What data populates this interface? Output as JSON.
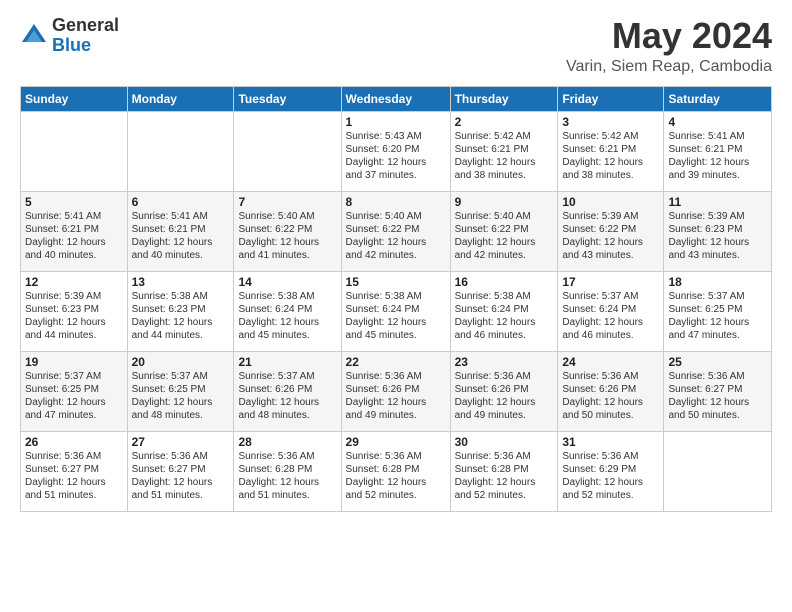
{
  "logo": {
    "general": "General",
    "blue": "Blue"
  },
  "title": "May 2024",
  "location": "Varin, Siem Reap, Cambodia",
  "days_header": [
    "Sunday",
    "Monday",
    "Tuesday",
    "Wednesday",
    "Thursday",
    "Friday",
    "Saturday"
  ],
  "weeks": [
    [
      {
        "day": "",
        "sunrise": "",
        "sunset": "",
        "daylight": ""
      },
      {
        "day": "",
        "sunrise": "",
        "sunset": "",
        "daylight": ""
      },
      {
        "day": "",
        "sunrise": "",
        "sunset": "",
        "daylight": ""
      },
      {
        "day": "1",
        "sunrise": "Sunrise: 5:43 AM",
        "sunset": "Sunset: 6:20 PM",
        "daylight": "Daylight: 12 hours and 37 minutes."
      },
      {
        "day": "2",
        "sunrise": "Sunrise: 5:42 AM",
        "sunset": "Sunset: 6:21 PM",
        "daylight": "Daylight: 12 hours and 38 minutes."
      },
      {
        "day": "3",
        "sunrise": "Sunrise: 5:42 AM",
        "sunset": "Sunset: 6:21 PM",
        "daylight": "Daylight: 12 hours and 38 minutes."
      },
      {
        "day": "4",
        "sunrise": "Sunrise: 5:41 AM",
        "sunset": "Sunset: 6:21 PM",
        "daylight": "Daylight: 12 hours and 39 minutes."
      }
    ],
    [
      {
        "day": "5",
        "sunrise": "Sunrise: 5:41 AM",
        "sunset": "Sunset: 6:21 PM",
        "daylight": "Daylight: 12 hours and 40 minutes."
      },
      {
        "day": "6",
        "sunrise": "Sunrise: 5:41 AM",
        "sunset": "Sunset: 6:21 PM",
        "daylight": "Daylight: 12 hours and 40 minutes."
      },
      {
        "day": "7",
        "sunrise": "Sunrise: 5:40 AM",
        "sunset": "Sunset: 6:22 PM",
        "daylight": "Daylight: 12 hours and 41 minutes."
      },
      {
        "day": "8",
        "sunrise": "Sunrise: 5:40 AM",
        "sunset": "Sunset: 6:22 PM",
        "daylight": "Daylight: 12 hours and 42 minutes."
      },
      {
        "day": "9",
        "sunrise": "Sunrise: 5:40 AM",
        "sunset": "Sunset: 6:22 PM",
        "daylight": "Daylight: 12 hours and 42 minutes."
      },
      {
        "day": "10",
        "sunrise": "Sunrise: 5:39 AM",
        "sunset": "Sunset: 6:22 PM",
        "daylight": "Daylight: 12 hours and 43 minutes."
      },
      {
        "day": "11",
        "sunrise": "Sunrise: 5:39 AM",
        "sunset": "Sunset: 6:23 PM",
        "daylight": "Daylight: 12 hours and 43 minutes."
      }
    ],
    [
      {
        "day": "12",
        "sunrise": "Sunrise: 5:39 AM",
        "sunset": "Sunset: 6:23 PM",
        "daylight": "Daylight: 12 hours and 44 minutes."
      },
      {
        "day": "13",
        "sunrise": "Sunrise: 5:38 AM",
        "sunset": "Sunset: 6:23 PM",
        "daylight": "Daylight: 12 hours and 44 minutes."
      },
      {
        "day": "14",
        "sunrise": "Sunrise: 5:38 AM",
        "sunset": "Sunset: 6:24 PM",
        "daylight": "Daylight: 12 hours and 45 minutes."
      },
      {
        "day": "15",
        "sunrise": "Sunrise: 5:38 AM",
        "sunset": "Sunset: 6:24 PM",
        "daylight": "Daylight: 12 hours and 45 minutes."
      },
      {
        "day": "16",
        "sunrise": "Sunrise: 5:38 AM",
        "sunset": "Sunset: 6:24 PM",
        "daylight": "Daylight: 12 hours and 46 minutes."
      },
      {
        "day": "17",
        "sunrise": "Sunrise: 5:37 AM",
        "sunset": "Sunset: 6:24 PM",
        "daylight": "Daylight: 12 hours and 46 minutes."
      },
      {
        "day": "18",
        "sunrise": "Sunrise: 5:37 AM",
        "sunset": "Sunset: 6:25 PM",
        "daylight": "Daylight: 12 hours and 47 minutes."
      }
    ],
    [
      {
        "day": "19",
        "sunrise": "Sunrise: 5:37 AM",
        "sunset": "Sunset: 6:25 PM",
        "daylight": "Daylight: 12 hours and 47 minutes."
      },
      {
        "day": "20",
        "sunrise": "Sunrise: 5:37 AM",
        "sunset": "Sunset: 6:25 PM",
        "daylight": "Daylight: 12 hours and 48 minutes."
      },
      {
        "day": "21",
        "sunrise": "Sunrise: 5:37 AM",
        "sunset": "Sunset: 6:26 PM",
        "daylight": "Daylight: 12 hours and 48 minutes."
      },
      {
        "day": "22",
        "sunrise": "Sunrise: 5:36 AM",
        "sunset": "Sunset: 6:26 PM",
        "daylight": "Daylight: 12 hours and 49 minutes."
      },
      {
        "day": "23",
        "sunrise": "Sunrise: 5:36 AM",
        "sunset": "Sunset: 6:26 PM",
        "daylight": "Daylight: 12 hours and 49 minutes."
      },
      {
        "day": "24",
        "sunrise": "Sunrise: 5:36 AM",
        "sunset": "Sunset: 6:26 PM",
        "daylight": "Daylight: 12 hours and 50 minutes."
      },
      {
        "day": "25",
        "sunrise": "Sunrise: 5:36 AM",
        "sunset": "Sunset: 6:27 PM",
        "daylight": "Daylight: 12 hours and 50 minutes."
      }
    ],
    [
      {
        "day": "26",
        "sunrise": "Sunrise: 5:36 AM",
        "sunset": "Sunset: 6:27 PM",
        "daylight": "Daylight: 12 hours and 51 minutes."
      },
      {
        "day": "27",
        "sunrise": "Sunrise: 5:36 AM",
        "sunset": "Sunset: 6:27 PM",
        "daylight": "Daylight: 12 hours and 51 minutes."
      },
      {
        "day": "28",
        "sunrise": "Sunrise: 5:36 AM",
        "sunset": "Sunset: 6:28 PM",
        "daylight": "Daylight: 12 hours and 51 minutes."
      },
      {
        "day": "29",
        "sunrise": "Sunrise: 5:36 AM",
        "sunset": "Sunset: 6:28 PM",
        "daylight": "Daylight: 12 hours and 52 minutes."
      },
      {
        "day": "30",
        "sunrise": "Sunrise: 5:36 AM",
        "sunset": "Sunset: 6:28 PM",
        "daylight": "Daylight: 12 hours and 52 minutes."
      },
      {
        "day": "31",
        "sunrise": "Sunrise: 5:36 AM",
        "sunset": "Sunset: 6:29 PM",
        "daylight": "Daylight: 12 hours and 52 minutes."
      },
      {
        "day": "",
        "sunrise": "",
        "sunset": "",
        "daylight": ""
      }
    ]
  ]
}
